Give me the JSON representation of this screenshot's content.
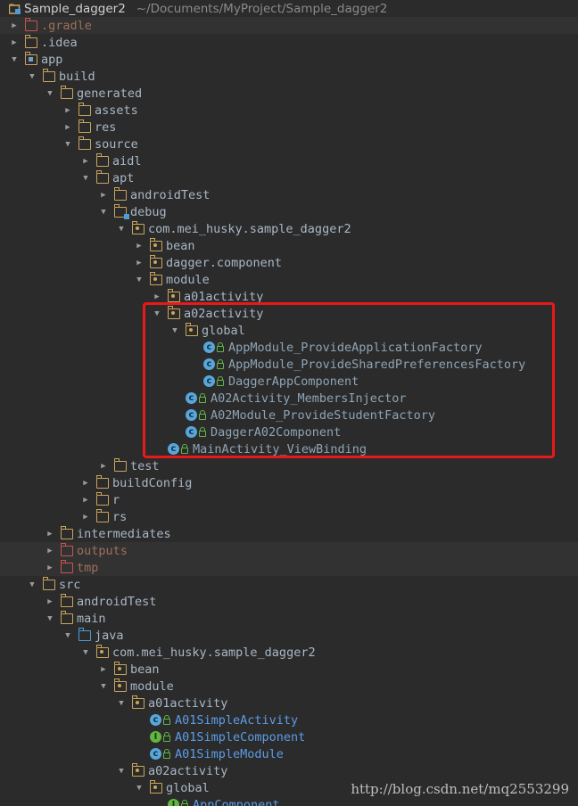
{
  "header": {
    "project_name": "Sample_dagger2",
    "project_path": "~/Documents/MyProject/Sample_dagger2"
  },
  "tree": [
    {
      "label": "gradle",
      "display": ".gradle",
      "level": 0,
      "arrow": "right",
      "icon": "folder-excluded",
      "style": "excluded",
      "shade": true
    },
    {
      "display": ".idea",
      "level": 0,
      "arrow": "right",
      "icon": "folder",
      "style": "normal"
    },
    {
      "display": "app",
      "level": 0,
      "arrow": "down",
      "icon": "folder-module",
      "style": "normal"
    },
    {
      "display": "build",
      "level": 1,
      "arrow": "down",
      "icon": "folder",
      "style": "normal"
    },
    {
      "display": "generated",
      "level": 2,
      "arrow": "down",
      "icon": "folder",
      "style": "normal"
    },
    {
      "display": "assets",
      "level": 3,
      "arrow": "right",
      "icon": "folder",
      "style": "normal"
    },
    {
      "display": "res",
      "level": 3,
      "arrow": "right",
      "icon": "folder",
      "style": "normal"
    },
    {
      "display": "source",
      "level": 3,
      "arrow": "down",
      "icon": "folder",
      "style": "normal"
    },
    {
      "display": "aidl",
      "level": 4,
      "arrow": "right",
      "icon": "folder",
      "style": "normal"
    },
    {
      "display": "apt",
      "level": 4,
      "arrow": "down",
      "icon": "folder",
      "style": "normal"
    },
    {
      "display": "androidTest",
      "level": 5,
      "arrow": "right",
      "icon": "folder",
      "style": "normal"
    },
    {
      "display": "debug",
      "level": 5,
      "arrow": "down",
      "icon": "folder-source",
      "style": "normal"
    },
    {
      "display": "com.mei_husky.sample_dagger2",
      "level": 6,
      "arrow": "down",
      "icon": "folder-package",
      "style": "normal"
    },
    {
      "display": "bean",
      "level": 7,
      "arrow": "right",
      "icon": "folder-package",
      "style": "normal"
    },
    {
      "display": "dagger.component",
      "level": 7,
      "arrow": "right",
      "icon": "folder-package",
      "style": "normal"
    },
    {
      "display": "module",
      "level": 7,
      "arrow": "down",
      "icon": "folder-package",
      "style": "normal"
    },
    {
      "display": "a01activity",
      "level": 8,
      "arrow": "right",
      "icon": "folder-package",
      "style": "normal"
    },
    {
      "display": "a02activity",
      "level": 8,
      "arrow": "down",
      "icon": "folder-package",
      "style": "normal"
    },
    {
      "display": "global",
      "level": 9,
      "arrow": "down",
      "icon": "folder-package",
      "style": "normal"
    },
    {
      "display": "AppModule_ProvideApplicationFactory",
      "level": 10,
      "arrow": "none",
      "icon": "class",
      "style": "gen"
    },
    {
      "display": "AppModule_ProvideSharedPreferencesFactory",
      "level": 10,
      "arrow": "none",
      "icon": "class",
      "style": "gen"
    },
    {
      "display": "DaggerAppComponent",
      "level": 10,
      "arrow": "none",
      "icon": "class",
      "style": "gen"
    },
    {
      "display": "A02Activity_MembersInjector",
      "level": 9,
      "arrow": "none",
      "icon": "class",
      "style": "gen"
    },
    {
      "display": "A02Module_ProvideStudentFactory",
      "level": 9,
      "arrow": "none",
      "icon": "class",
      "style": "gen"
    },
    {
      "display": "DaggerA02Component",
      "level": 9,
      "arrow": "none",
      "icon": "class",
      "style": "gen"
    },
    {
      "display": "MainActivity_ViewBinding",
      "level": 8,
      "arrow": "none",
      "icon": "class",
      "style": "gen"
    },
    {
      "display": "test",
      "level": 5,
      "arrow": "right",
      "icon": "folder",
      "style": "normal"
    },
    {
      "display": "buildConfig",
      "level": 4,
      "arrow": "right",
      "icon": "folder",
      "style": "normal"
    },
    {
      "display": "r",
      "level": 4,
      "arrow": "right",
      "icon": "folder",
      "style": "normal"
    },
    {
      "display": "rs",
      "level": 4,
      "arrow": "right",
      "icon": "folder",
      "style": "normal"
    },
    {
      "display": "intermediates",
      "level": 2,
      "arrow": "right",
      "icon": "folder",
      "style": "normal"
    },
    {
      "display": "outputs",
      "level": 2,
      "arrow": "right",
      "icon": "folder-excluded",
      "style": "excluded",
      "shade": true
    },
    {
      "display": "tmp",
      "level": 2,
      "arrow": "right",
      "icon": "folder-excluded",
      "style": "excluded",
      "shade": true
    },
    {
      "display": "src",
      "level": 1,
      "arrow": "down",
      "icon": "folder",
      "style": "normal"
    },
    {
      "display": "androidTest",
      "level": 2,
      "arrow": "right",
      "icon": "folder",
      "style": "normal"
    },
    {
      "display": "main",
      "level": 2,
      "arrow": "down",
      "icon": "folder",
      "style": "normal"
    },
    {
      "display": "java",
      "level": 3,
      "arrow": "down",
      "icon": "folder-java",
      "style": "normal"
    },
    {
      "display": "com.mei_husky.sample_dagger2",
      "level": 4,
      "arrow": "down",
      "icon": "folder-package",
      "style": "normal"
    },
    {
      "display": "bean",
      "level": 5,
      "arrow": "right",
      "icon": "folder-package",
      "style": "normal"
    },
    {
      "display": "module",
      "level": 5,
      "arrow": "down",
      "icon": "folder-package",
      "style": "normal"
    },
    {
      "display": "a01activity",
      "level": 6,
      "arrow": "down",
      "icon": "folder-package",
      "style": "normal"
    },
    {
      "display": "A01SimpleActivity",
      "level": 7,
      "arrow": "none",
      "icon": "class",
      "style": "java"
    },
    {
      "display": "A01SimpleComponent",
      "level": 7,
      "arrow": "none",
      "icon": "interface",
      "style": "java"
    },
    {
      "display": "A01SimpleModule",
      "level": 7,
      "arrow": "none",
      "icon": "class",
      "style": "java"
    },
    {
      "display": "a02activity",
      "level": 6,
      "arrow": "down",
      "icon": "folder-package",
      "style": "normal"
    },
    {
      "display": "global",
      "level": 7,
      "arrow": "down",
      "icon": "folder-package",
      "style": "normal"
    },
    {
      "display": "AppComponent",
      "level": 8,
      "arrow": "none",
      "icon": "interface",
      "style": "java"
    }
  ],
  "watermark": "http://blog.csdn.net/mq2553299"
}
